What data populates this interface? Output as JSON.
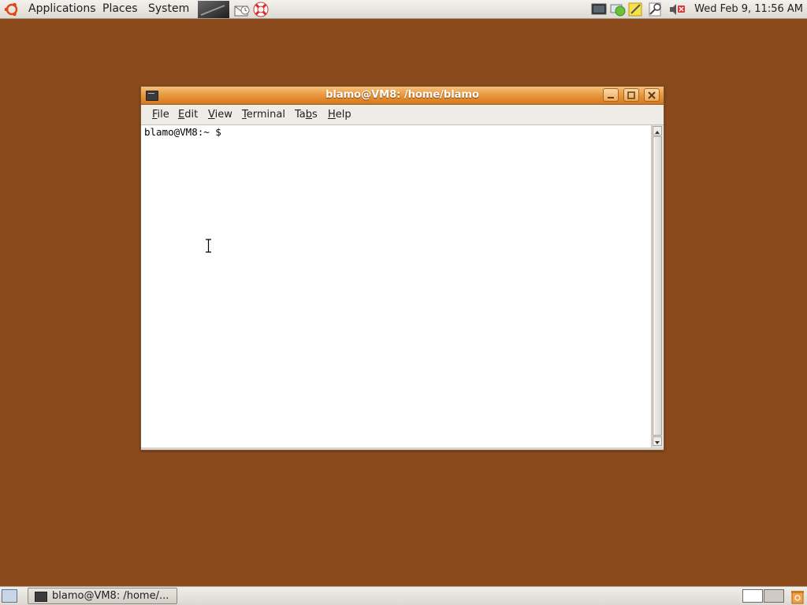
{
  "top_panel": {
    "menus": [
      "Applications",
      "Places",
      "System"
    ],
    "launchers": [
      "terminal-launcher-icon",
      "mail-client-icon",
      "help-lifebuoy-icon"
    ],
    "tray_icons": [
      "monitor-icon",
      "network-status-icon",
      "notes-icon",
      "search-icon",
      "volume-muted-icon"
    ],
    "clock": "Wed Feb  9, 11:56 AM"
  },
  "window": {
    "title": "blamo@VM8: /home/blamo",
    "menu": [
      {
        "pre": "",
        "ul": "F",
        "post": "ile"
      },
      {
        "pre": "",
        "ul": "E",
        "post": "dit"
      },
      {
        "pre": "",
        "ul": "V",
        "post": "iew"
      },
      {
        "pre": "",
        "ul": "T",
        "post": "erminal"
      },
      {
        "pre": "Ta",
        "ul": "b",
        "post": "s"
      },
      {
        "pre": "",
        "ul": "H",
        "post": "elp"
      }
    ],
    "prompt": "blamo@VM8:~ $"
  },
  "bottom_panel": {
    "task_label": "blamo@VM8: /home/..."
  },
  "colors": {
    "desktop": "#8b4a1c",
    "titlebar": "#e99a3f"
  }
}
